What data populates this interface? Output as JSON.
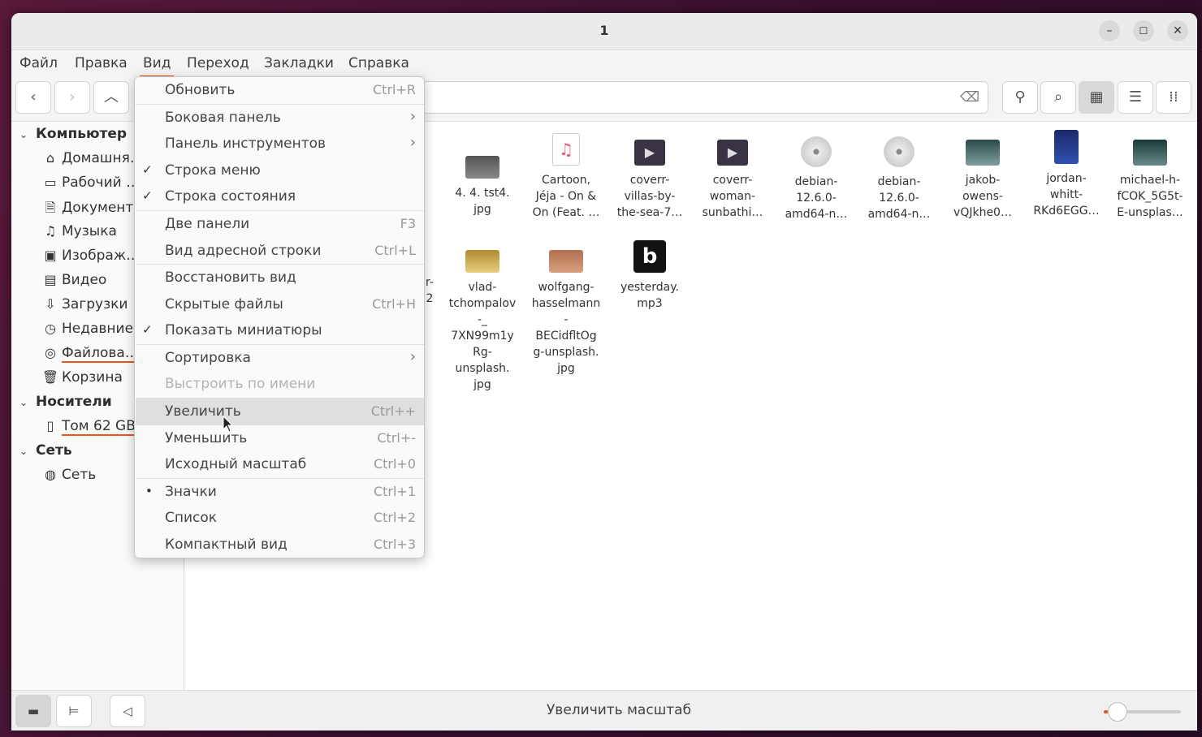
{
  "window": {
    "title": "1"
  },
  "menubar": [
    {
      "label": "Файл"
    },
    {
      "label": "Правка"
    },
    {
      "label": "Вид"
    },
    {
      "label": "Переход"
    },
    {
      "label": "Закладки"
    },
    {
      "label": "Справка"
    }
  ],
  "sidebar": {
    "sections": [
      {
        "label": "Компьютер"
      },
      {
        "label": "Носители"
      },
      {
        "label": "Сеть"
      }
    ],
    "items": [
      {
        "label": "Домашня…",
        "icon": "home-icon"
      },
      {
        "label": "Рабочий …",
        "icon": "desktop-icon"
      },
      {
        "label": "Документы",
        "icon": "documents-icon"
      },
      {
        "label": "Музыка",
        "icon": "music-icon"
      },
      {
        "label": "Изображ…",
        "icon": "pictures-icon"
      },
      {
        "label": "Видео",
        "icon": "video-icon"
      },
      {
        "label": "Загрузки",
        "icon": "downloads-icon"
      },
      {
        "label": "Недавние",
        "icon": "recent-icon"
      },
      {
        "label": "Файлова…",
        "icon": "filesystem-icon"
      },
      {
        "label": "Корзина",
        "icon": "trash-icon"
      },
      {
        "label": "Том 62 GB",
        "icon": "usb-drive-icon"
      },
      {
        "label": "Сеть",
        "icon": "network-icon"
      }
    ]
  },
  "view_menu": [
    {
      "label": "Обновить",
      "accel": "Ctrl+R"
    },
    {
      "label": "Боковая панель",
      "submenu": "›"
    },
    {
      "label": "Панель инструментов",
      "submenu": "›"
    },
    {
      "label": "Строка меню",
      "check": "✓"
    },
    {
      "label": "Строка состояния",
      "check": "✓"
    },
    {
      "label": "Две панели",
      "accel": "F3"
    },
    {
      "label": "Вид адресной строки",
      "accel": "Ctrl+L"
    },
    {
      "label": "Восстановить вид"
    },
    {
      "label": "Скрытые файлы",
      "accel": "Ctrl+H"
    },
    {
      "label": "Показать миниатюры",
      "check": "✓"
    },
    {
      "label": "Сортировка",
      "submenu": "›"
    },
    {
      "label": "Выстроить по имени"
    },
    {
      "label": "Увеличить",
      "accel": "Ctrl++"
    },
    {
      "label": "Уменьшить",
      "accel": "Ctrl+-"
    },
    {
      "label": "Исходный масштаб",
      "accel": "Ctrl+0"
    },
    {
      "label": "Значки",
      "accel": "Ctrl+1",
      "check": "•"
    },
    {
      "label": "Список",
      "accel": "Ctrl+2"
    },
    {
      "label": "Компактный вид",
      "accel": "Ctrl+3"
    }
  ],
  "files": [
    {
      "name": "4. 4. tst4.\njpg"
    },
    {
      "name": "Cartoon,\nJéja - On &\nOn (Feat. …"
    },
    {
      "name": "coverr-\nvillas-by-\nthe-sea-7…"
    },
    {
      "name": "coverr-\nwoman-\nsunbathi…"
    },
    {
      "name": "debian-\n12.6.0-\namd64-n…"
    },
    {
      "name": "debian-\n12.6.0-\namd64-n…"
    },
    {
      "name": "jakob-\nowens-\nvQJkhe0…"
    },
    {
      "name": "jordan-\nwhitt-\nRKd6EGG…"
    },
    {
      "name": "michael-h-\nfCOK_5G5t-\nE-unsplas…"
    },
    {
      "name": "vlad-\ntchompalov\n-_\n7XN99m1y\nRg-\nunsplash.\njpg"
    },
    {
      "name": "wolfgang-\nhasselmann\n-\nBECidfltOg\ng-unsplash.\njpg"
    },
    {
      "name": "yesterday.\nmp3"
    }
  ],
  "partial_file_fragments": [
    "r-",
    "2"
  ],
  "statusbar": {
    "text": "Увеличить масштаб",
    "zoom_fraction": 0.05
  },
  "colors": {
    "accent": "#e95420"
  }
}
